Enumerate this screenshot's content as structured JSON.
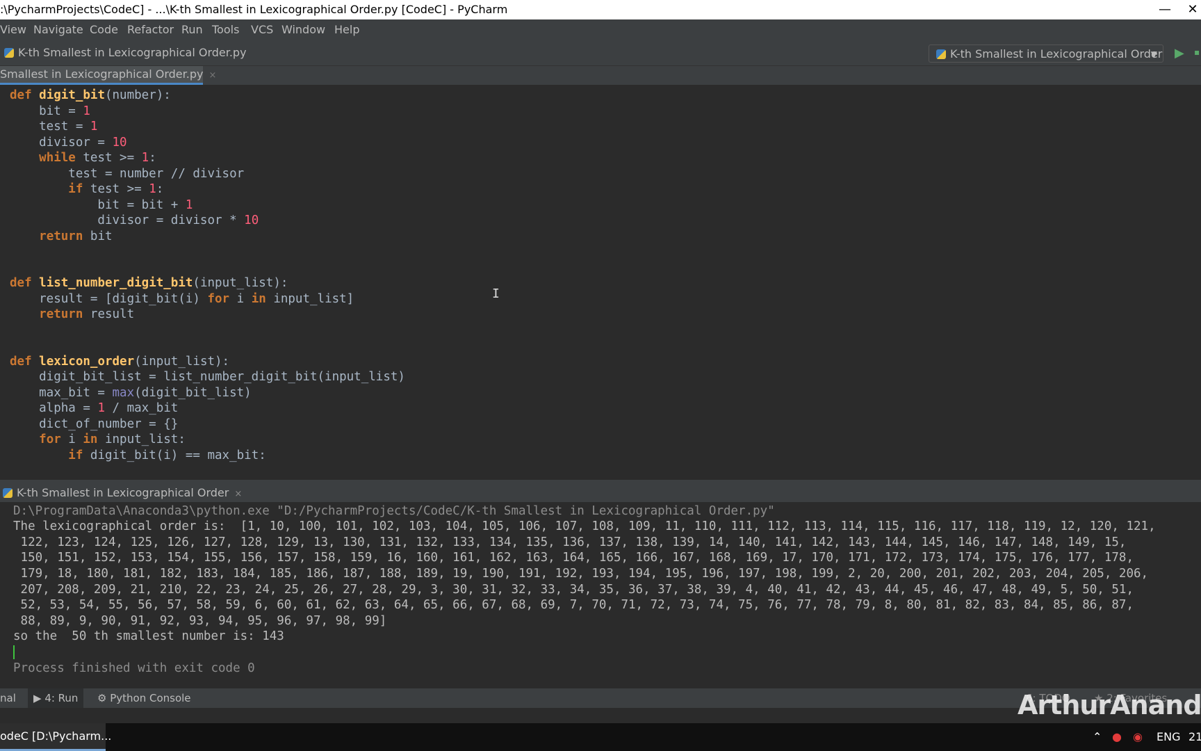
{
  "window": {
    "title": ":\\PycharmProjects\\CodeC] - ...\\K-th Smallest in Lexicographical Order.py [CodeC] - PyCharm",
    "min_glyph": "—",
    "close_glyph": "✕"
  },
  "menu": [
    "View",
    "Navigate",
    "Code",
    "Refactor",
    "Run",
    "Tools",
    "VCS",
    "Window",
    "Help"
  ],
  "navbar": {
    "breadcrumb": "K-th Smallest in Lexicographical Order.py",
    "run_config": "K-th Smallest in Lexicographical Order"
  },
  "editor_tab": {
    "label": "Smallest in Lexicographical Order.py",
    "close": "×"
  },
  "code_lines": [
    "def digit_bit(number):",
    "    bit = 1",
    "    test = 1",
    "    divisor = 10",
    "    while test >= 1:",
    "        test = number // divisor",
    "        if test >= 1:",
    "            bit = bit + 1",
    "            divisor = divisor * 10",
    "    return bit",
    "",
    "",
    "def list_number_digit_bit(input_list):",
    "    result = [digit_bit(i) for i in input_list]",
    "    return result",
    "",
    "",
    "def lexicon_order(input_list):",
    "    digit_bit_list = list_number_digit_bit(input_list)",
    "    max_bit = max(digit_bit_list)",
    "    alpha = 1 / max_bit",
    "    dict_of_number = {}",
    "    for i in input_list:",
    "        if digit_bit(i) == max_bit:"
  ],
  "run_panel": {
    "title": "K-th Smallest in Lexicographical Order",
    "close": "×",
    "output": [
      "D:\\ProgramData\\Anaconda3\\python.exe \"D:/PycharmProjects/CodeC/K-th Smallest in Lexicographical Order.py\"",
      "The lexicographical order is:  [1, 10, 100, 101, 102, 103, 104, 105, 106, 107, 108, 109, 11, 110, 111, 112, 113, 114, 115, 116, 117, 118, 119, 12, 120, 121,",
      " 122, 123, 124, 125, 126, 127, 128, 129, 13, 130, 131, 132, 133, 134, 135, 136, 137, 138, 139, 14, 140, 141, 142, 143, 144, 145, 146, 147, 148, 149, 15,",
      " 150, 151, 152, 153, 154, 155, 156, 157, 158, 159, 16, 160, 161, 162, 163, 164, 165, 166, 167, 168, 169, 17, 170, 171, 172, 173, 174, 175, 176, 177, 178,",
      " 179, 18, 180, 181, 182, 183, 184, 185, 186, 187, 188, 189, 19, 190, 191, 192, 193, 194, 195, 196, 197, 198, 199, 2, 20, 200, 201, 202, 203, 204, 205, 206,",
      " 207, 208, 209, 21, 210, 22, 23, 24, 25, 26, 27, 28, 29, 3, 30, 31, 32, 33, 34, 35, 36, 37, 38, 39, 4, 40, 41, 42, 43, 44, 45, 46, 47, 48, 49, 5, 50, 51,",
      " 52, 53, 54, 55, 56, 57, 58, 59, 6, 60, 61, 62, 63, 64, 65, 66, 67, 68, 69, 7, 70, 71, 72, 73, 74, 75, 76, 77, 78, 79, 8, 80, 81, 82, 83, 84, 85, 86, 87,",
      " 88, 89, 9, 90, 91, 92, 93, 94, 95, 96, 97, 98, 99]",
      "so the  50 th smallest number is: 143"
    ],
    "exit": "Process finished with exit code 0"
  },
  "bottom_tabs": {
    "terminal": "nal",
    "run": "4: Run",
    "python_console": "Python Console",
    "todo": "6: TODO",
    "favorites": "2: Favorites"
  },
  "watermark": "ArthurAnanda",
  "taskbar": {
    "app": "odeC [D:\\Pycharm...",
    "lang": "ENG",
    "time": "21"
  }
}
